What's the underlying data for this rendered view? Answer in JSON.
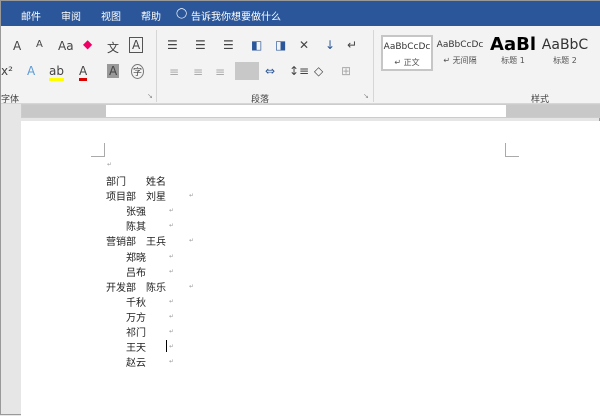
{
  "tabs": [
    "邮件",
    "审阅",
    "视图",
    "帮助"
  ],
  "tell_me": "告诉我你想要做什么",
  "groups": {
    "font": "字体",
    "paragraph": "段落",
    "styles": "样式"
  },
  "styles": [
    {
      "preview": "AaBbCcDc",
      "name": "↵ 正文"
    },
    {
      "preview": "AaBbCcDc",
      "name": "↵ 无间隔"
    },
    {
      "preview": "AaBl",
      "name": "标题 1"
    },
    {
      "preview": "AaBbC",
      "name": "标题 2"
    }
  ],
  "font_buttons": [
    "A",
    "A",
    "Aa",
    "文",
    "A",
    "x²",
    "A",
    "ab",
    "A",
    "A",
    "字"
  ],
  "document": {
    "header": {
      "dept": "部门",
      "name": "姓名"
    },
    "rows": [
      {
        "dept": "项目部",
        "name": "刘星"
      },
      {
        "dept": "",
        "name": "张强"
      },
      {
        "dept": "",
        "name": "陈其"
      },
      {
        "dept": "营销部",
        "name": "王兵"
      },
      {
        "dept": "",
        "name": "郑晓"
      },
      {
        "dept": "",
        "name": "吕布"
      },
      {
        "dept": "开发部",
        "name": "陈乐"
      },
      {
        "dept": "",
        "name": "千秋"
      },
      {
        "dept": "",
        "name": "万方"
      },
      {
        "dept": "",
        "name": "祁门"
      },
      {
        "dept": "",
        "name": "王天"
      },
      {
        "dept": "",
        "name": "赵云"
      }
    ]
  }
}
